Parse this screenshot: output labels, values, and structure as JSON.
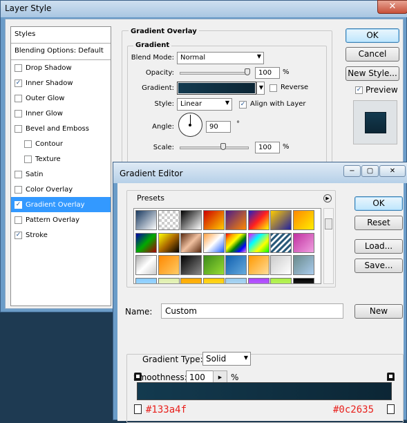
{
  "layer_style": {
    "title": "Layer Style",
    "close_glyph": "✕",
    "styles_header": "Styles",
    "blending_options": "Blending Options: Default",
    "items": [
      {
        "label": "Drop Shadow",
        "checked": false
      },
      {
        "label": "Inner Shadow",
        "checked": true
      },
      {
        "label": "Outer Glow",
        "checked": false
      },
      {
        "label": "Inner Glow",
        "checked": false
      },
      {
        "label": "Bevel and Emboss",
        "checked": false
      },
      {
        "label": "Contour",
        "checked": false
      },
      {
        "label": "Texture",
        "checked": false
      },
      {
        "label": "Satin",
        "checked": false
      },
      {
        "label": "Color Overlay",
        "checked": false
      },
      {
        "label": "Gradient Overlay",
        "checked": true
      },
      {
        "label": "Pattern Overlay",
        "checked": false
      },
      {
        "label": "Stroke",
        "checked": true
      }
    ],
    "panel": {
      "section_title": "Gradient Overlay",
      "group_title": "Gradient",
      "blend_mode_label": "Blend Mode:",
      "blend_mode_value": "Normal",
      "opacity_label": "Opacity:",
      "opacity_value": "100",
      "opacity_unit": "%",
      "gradient_label": "Gradient:",
      "reverse_label": "Reverse",
      "style_label": "Style:",
      "style_value": "Linear",
      "align_label": "Align with Layer",
      "angle_label": "Angle:",
      "angle_value": "90",
      "angle_unit": "°",
      "scale_label": "Scale:",
      "scale_value": "100",
      "scale_unit": "%"
    },
    "buttons": {
      "ok": "OK",
      "cancel": "Cancel",
      "new_style": "New Style...",
      "preview": "Preview"
    }
  },
  "gradient_editor": {
    "title": "Gradient Editor",
    "minimize_glyph": "−",
    "maximize_glyph": "▢",
    "close_glyph": "✕",
    "presets_label": "Presets",
    "buttons": {
      "ok": "OK",
      "reset": "Reset",
      "load": "Load...",
      "save": "Save...",
      "new": "New"
    },
    "name_label": "Name:",
    "name_value": "Custom",
    "gradient_type_label": "Gradient Type:",
    "gradient_type_value": "Solid",
    "smoothness_label": "Smoothness:",
    "smoothness_value": "100",
    "smoothness_unit": "%",
    "stop_left_color": "#133a4f",
    "stop_right_color": "#0c2635"
  },
  "colors": {
    "gradient_start": "#133a4f",
    "gradient_end": "#0c2635",
    "selection": "#3399ff",
    "annotation_red": "#e8201c"
  }
}
